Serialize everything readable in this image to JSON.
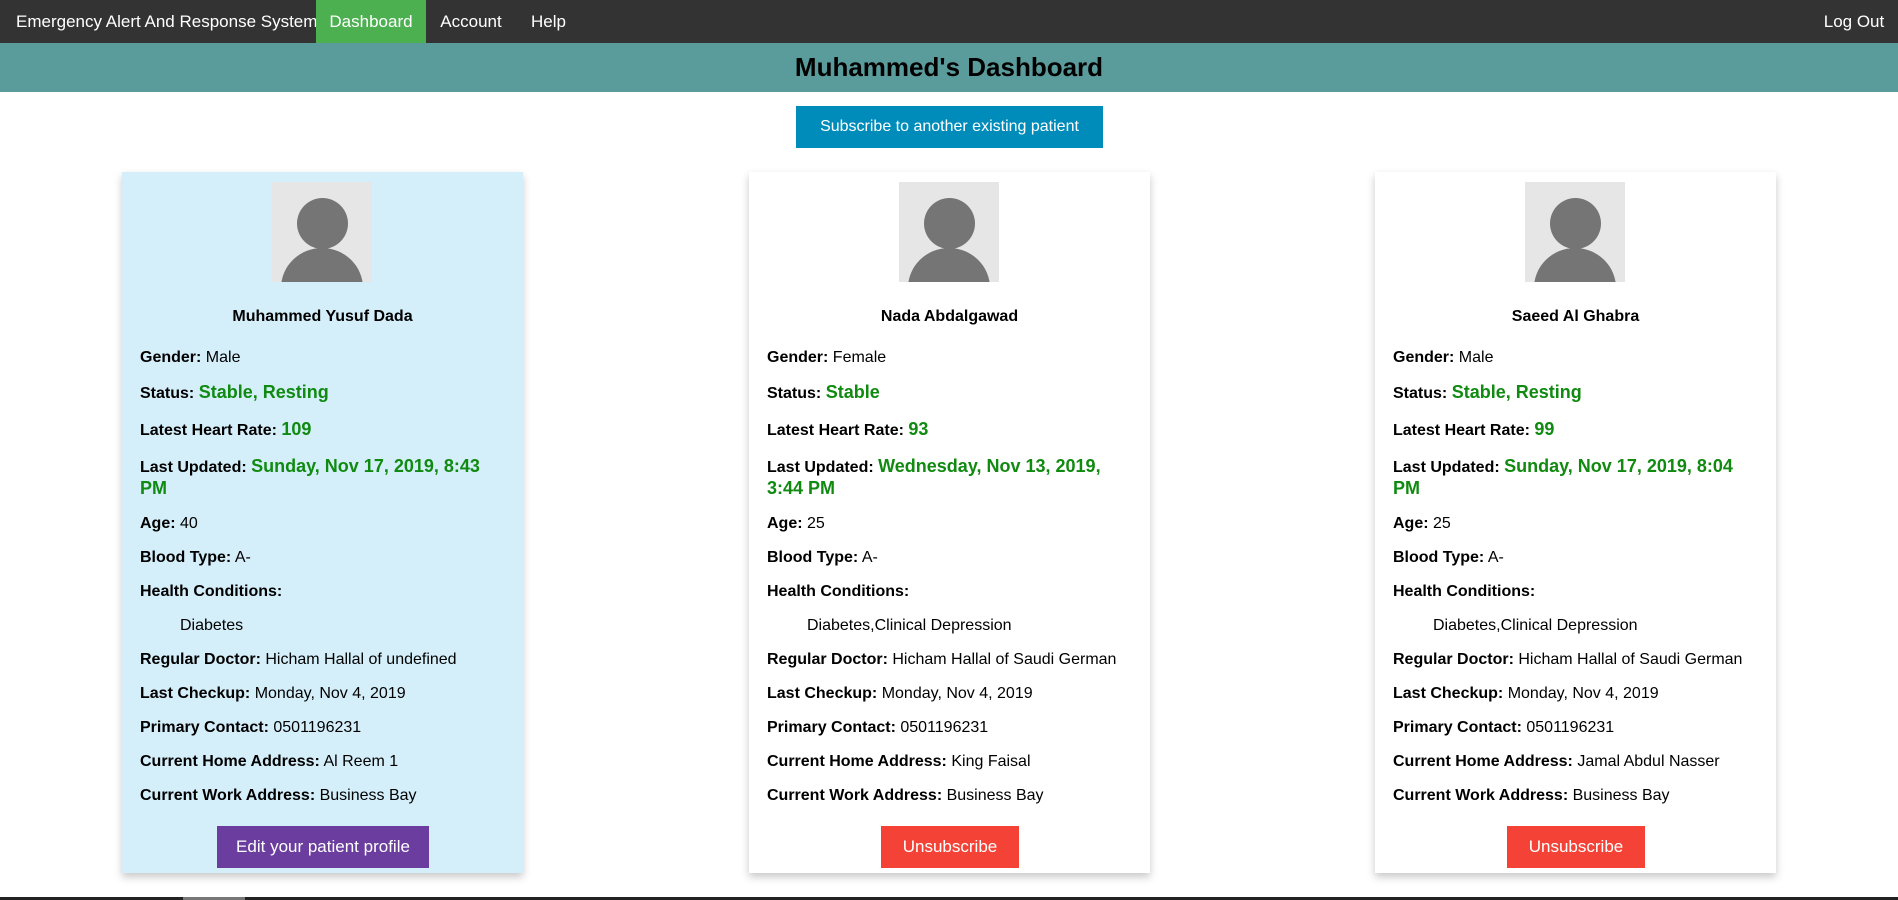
{
  "nav": {
    "brand": "Emergency Alert And Response System",
    "dashboard": "Dashboard",
    "account": "Account",
    "help": "Help",
    "logout": "Log Out"
  },
  "banner": {
    "title": "Muhammed's Dashboard"
  },
  "subscribe_label": "Subscribe to another existing patient",
  "labels": {
    "gender": "Gender:",
    "status": "Status:",
    "heart_rate": "Latest Heart Rate:",
    "last_updated": "Last Updated:",
    "age": "Age:",
    "blood_type": "Blood Type:",
    "health_conditions": "Health Conditions:",
    "regular_doctor": "Regular Doctor:",
    "last_checkup": "Last Checkup:",
    "primary_contact": "Primary Contact:",
    "home_address": "Current Home Address:",
    "work_address": "Current Work Address:"
  },
  "colors": {
    "status_green": "#108a10",
    "own_card": "#d4effa",
    "nav_active": "#4CAF50",
    "banner": "#5a9c9c"
  },
  "patients": [
    {
      "name": "Muhammed Yusuf Dada",
      "gender": "Male",
      "status": "Stable, Resting",
      "heart_rate": "109",
      "last_updated": "Sunday, Nov 17, 2019, 8:43 PM",
      "age": "40",
      "blood_type": "A-",
      "conditions": "Diabetes",
      "doctor": "Hicham Hallal of undefined",
      "checkup": "Monday, Nov 4, 2019",
      "contact": "0501196231",
      "home": "Al Reem 1",
      "work": "Business Bay",
      "action": "Edit your patient profile"
    },
    {
      "name": "Nada Abdalgawad",
      "gender": "Female",
      "status": "Stable",
      "heart_rate": "93",
      "last_updated": "Wednesday, Nov 13, 2019, 3:44 PM",
      "age": "25",
      "blood_type": "A-",
      "conditions": "Diabetes,Clinical Depression",
      "doctor": "Hicham Hallal of Saudi German",
      "checkup": "Monday, Nov 4, 2019",
      "contact": "0501196231",
      "home": "King Faisal",
      "work": "Business Bay",
      "action": "Unsubscribe"
    },
    {
      "name": "Saeed Al Ghabra",
      "gender": "Male",
      "status": "Stable, Resting",
      "heart_rate": "99",
      "last_updated": "Sunday, Nov 17, 2019, 8:04 PM",
      "age": "25",
      "blood_type": "A-",
      "conditions": "Diabetes,Clinical Depression",
      "doctor": "Hicham Hallal of Saudi German",
      "checkup": "Monday, Nov 4, 2019",
      "contact": "0501196231",
      "home": "Jamal Abdul Nasser",
      "work": "Business Bay",
      "action": "Unsubscribe"
    }
  ]
}
